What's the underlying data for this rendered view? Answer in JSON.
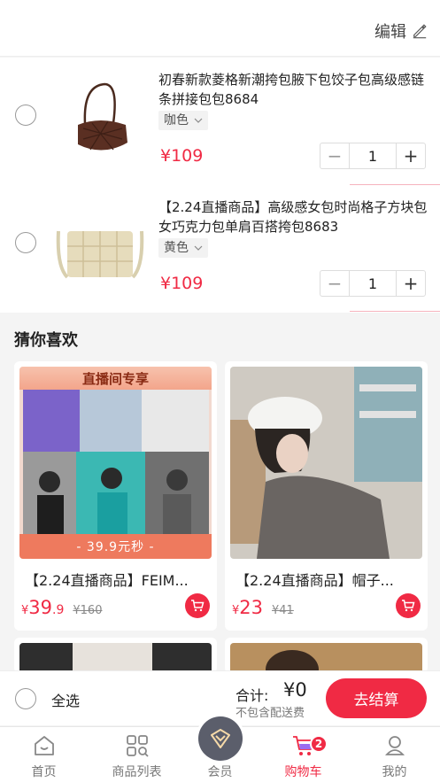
{
  "header": {
    "edit_label": "编辑"
  },
  "cart": {
    "items": [
      {
        "title": "初春新款菱格新潮挎包腋下包饺子包高级感链条拼接包包8684",
        "variant": "咖色",
        "price": "¥109",
        "quantity": "1"
      },
      {
        "title": "【2.24直播商品】高级感女包时尚格子方块包女巧克力包单肩百搭挎包8683",
        "variant": "黄色",
        "price": "¥109",
        "quantity": "1"
      }
    ]
  },
  "recommend": {
    "title": "猜你喜欢",
    "items": [
      {
        "banner": "直播间专享",
        "promo": "- 39.9元秒 -",
        "name": "【2.24直播商品】FEIM...",
        "currency": "¥",
        "price_int": "39",
        "price_dec": ".9",
        "orig_price": "¥160"
      },
      {
        "name": "【2.24直播商品】帽子...",
        "currency": "¥",
        "price_int": "23",
        "price_dec": "",
        "orig_price": "¥41"
      }
    ]
  },
  "checkout": {
    "select_all": "全选",
    "total_label": "合计:",
    "total_value": "¥0",
    "shipping_note": "不包含配送费",
    "pay_button": "去结算"
  },
  "tabbar": {
    "items": [
      {
        "label": "首页",
        "icon": "home-icon"
      },
      {
        "label": "商品列表",
        "icon": "grid-search-icon"
      },
      {
        "label": "会员",
        "icon": "member-diamond-icon"
      },
      {
        "label": "购物车",
        "icon": "cart-icon",
        "badge": "2"
      },
      {
        "label": "我的",
        "icon": "profile-icon"
      }
    ],
    "active": "购物车"
  },
  "colors": {
    "accent": "#f02a44",
    "background": "#f4f4f4",
    "member": "#5b5e6b"
  }
}
